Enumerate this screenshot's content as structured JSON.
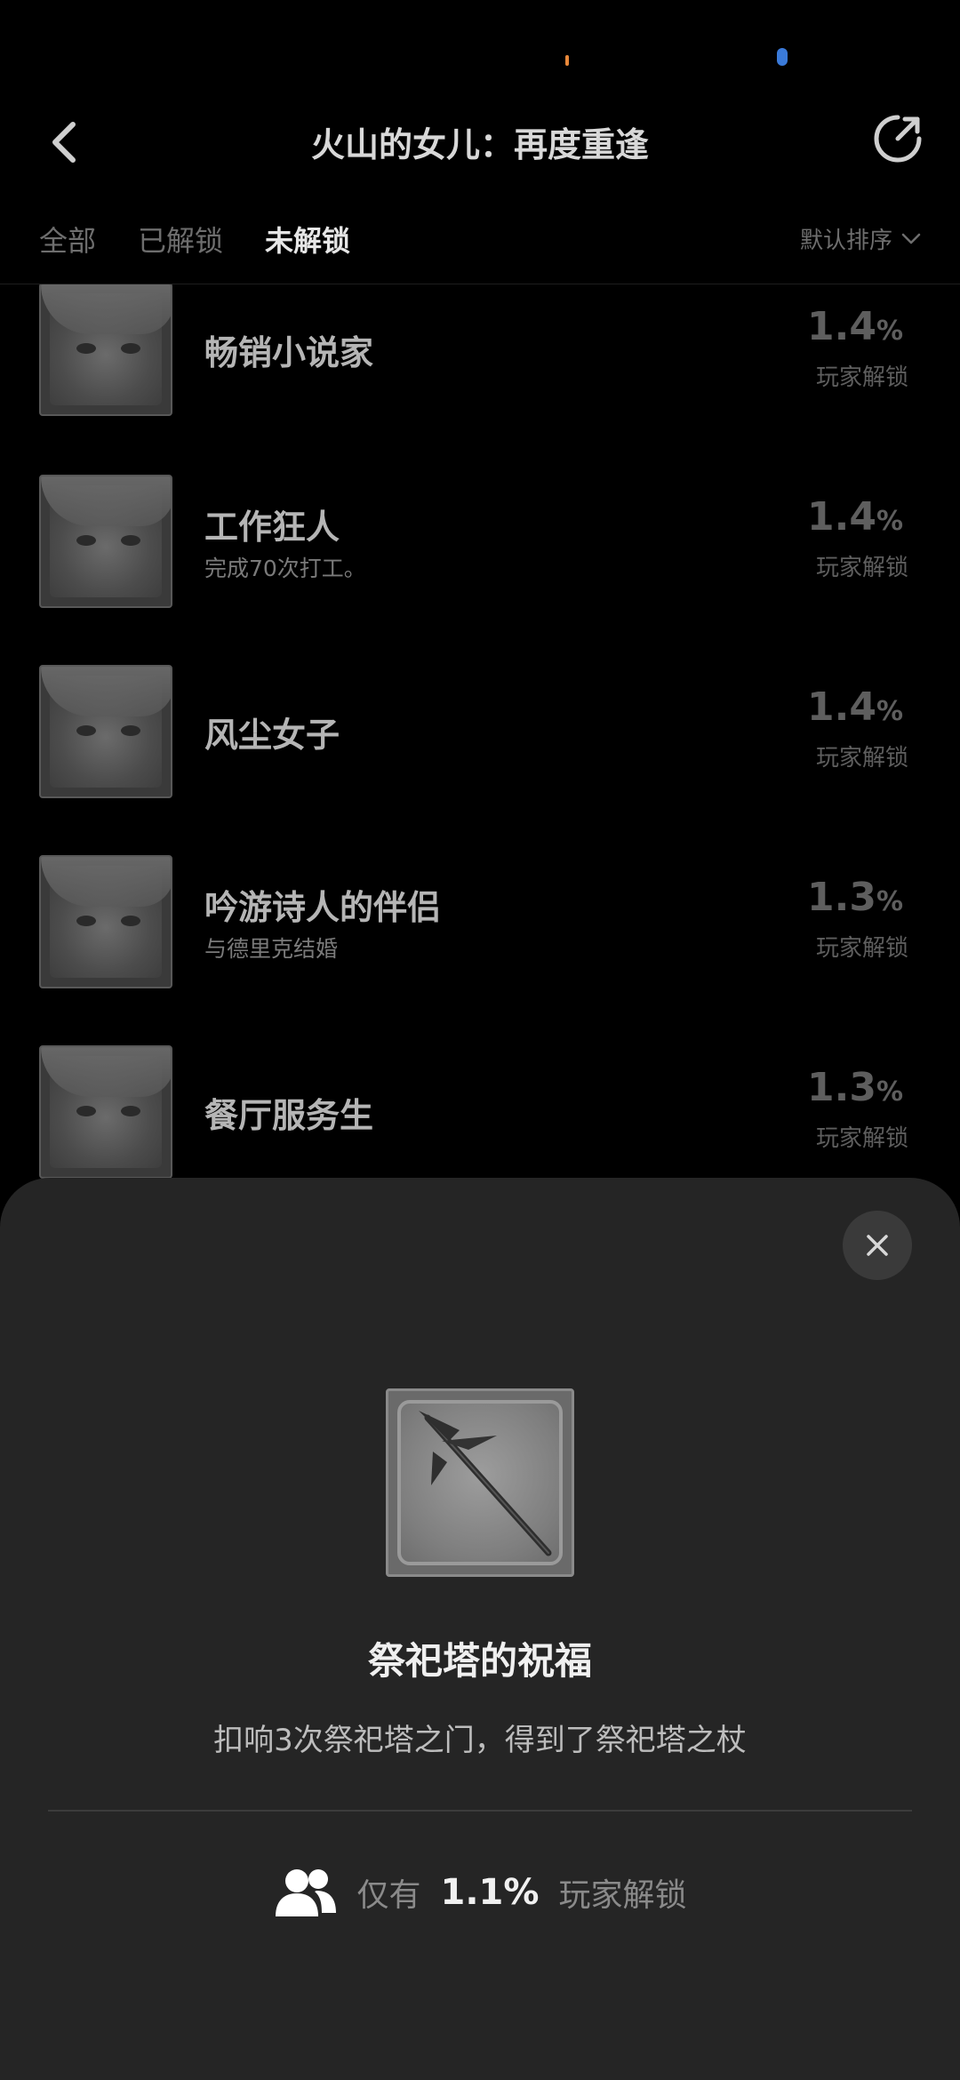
{
  "header": {
    "title": "火山的女儿：再度重逢"
  },
  "tabs": {
    "all": "全部",
    "unlocked": "已解锁",
    "locked": "未解锁"
  },
  "sort": {
    "label": "默认排序"
  },
  "list": [
    {
      "title": "畅销小说家",
      "desc": "",
      "pct": "1.4",
      "unit": "%",
      "pct_label": "玩家解锁"
    },
    {
      "title": "工作狂人",
      "desc": "完成70次打工。",
      "pct": "1.4",
      "unit": "%",
      "pct_label": "玩家解锁"
    },
    {
      "title": "风尘女子",
      "desc": "",
      "pct": "1.4",
      "unit": "%",
      "pct_label": "玩家解锁"
    },
    {
      "title": "吟游诗人的伴侣",
      "desc": "与德里克结婚",
      "pct": "1.3",
      "unit": "%",
      "pct_label": "玩家解锁"
    },
    {
      "title": "餐厅服务生",
      "desc": "",
      "pct": "1.3",
      "unit": "%",
      "pct_label": "玩家解锁"
    }
  ],
  "sheet": {
    "title": "祭祀塔的祝福",
    "desc": "扣响3次祭祀塔之门，得到了祭祀塔之杖",
    "prefix": "仅有",
    "value": "1.1%",
    "suffix": "玩家解锁"
  },
  "colors": {
    "background": "#000000",
    "sheet": "#252525",
    "accent_orange": "#e8883a",
    "accent_blue": "#3a7ad9"
  },
  "icons": {
    "back": "chevron-left-icon",
    "share": "share-icon",
    "sort": "chevron-down-icon",
    "close": "close-icon",
    "users": "users-icon",
    "badge": "staff-icon"
  }
}
